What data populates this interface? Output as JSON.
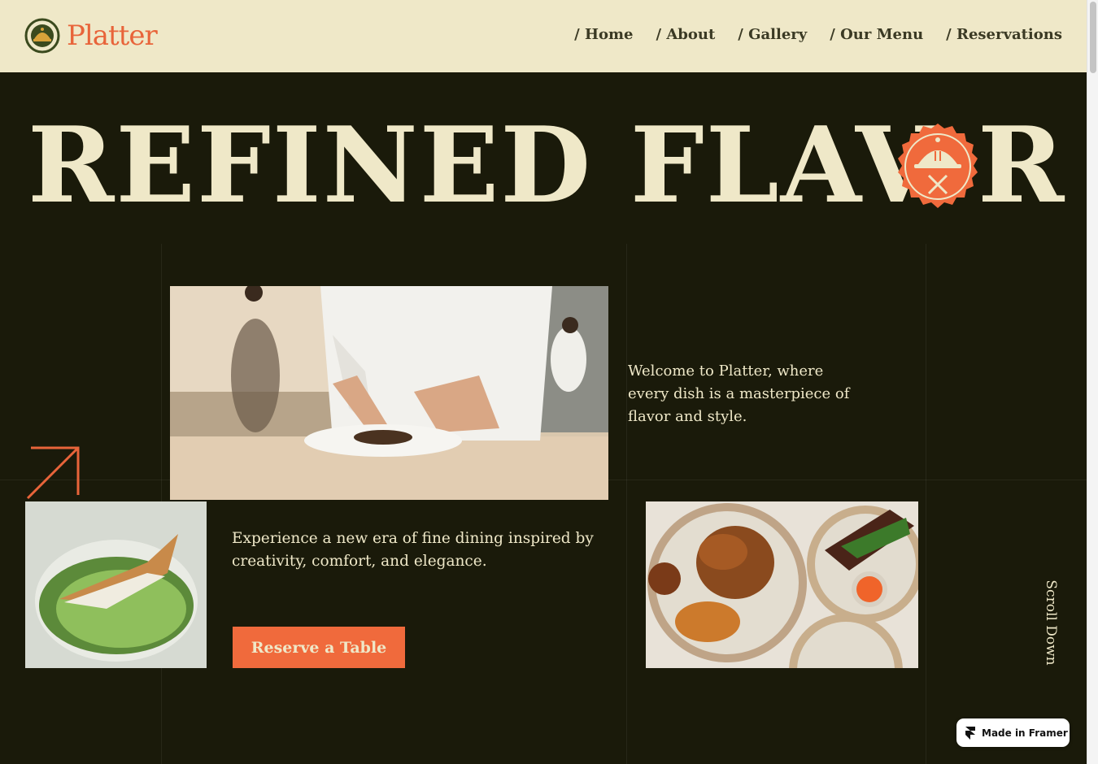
{
  "brand": {
    "name": "Platter"
  },
  "nav": {
    "items": [
      {
        "label": "/ Home"
      },
      {
        "label": "/ About"
      },
      {
        "label": "/ Gallery"
      },
      {
        "label": "/ Our Menu"
      },
      {
        "label": "/ Reservations"
      }
    ]
  },
  "hero": {
    "title_part1": "REFINED FLAV",
    "title_part2": "R",
    "welcome_text": "Welcome to Platter, where every dish is a masterpiece of flavor and style.",
    "experience_text": "Experience a new era of fine dining inspired by creativity, comfort, and elegance.",
    "cta_label": "Reserve a Table",
    "scroll_label": "Scroll Down"
  },
  "badge": {
    "label": "Made in Framer"
  },
  "colors": {
    "accent": "#f06a3c",
    "cream": "#efe8c8",
    "background": "#1a1a0a",
    "header_bg": "#efe8c8"
  },
  "icons": {
    "logo": "cloche-logo-icon",
    "hero_badge": "cloche-cutlery-icon",
    "arrow": "arrow-up-right-icon",
    "framer": "framer-icon"
  }
}
